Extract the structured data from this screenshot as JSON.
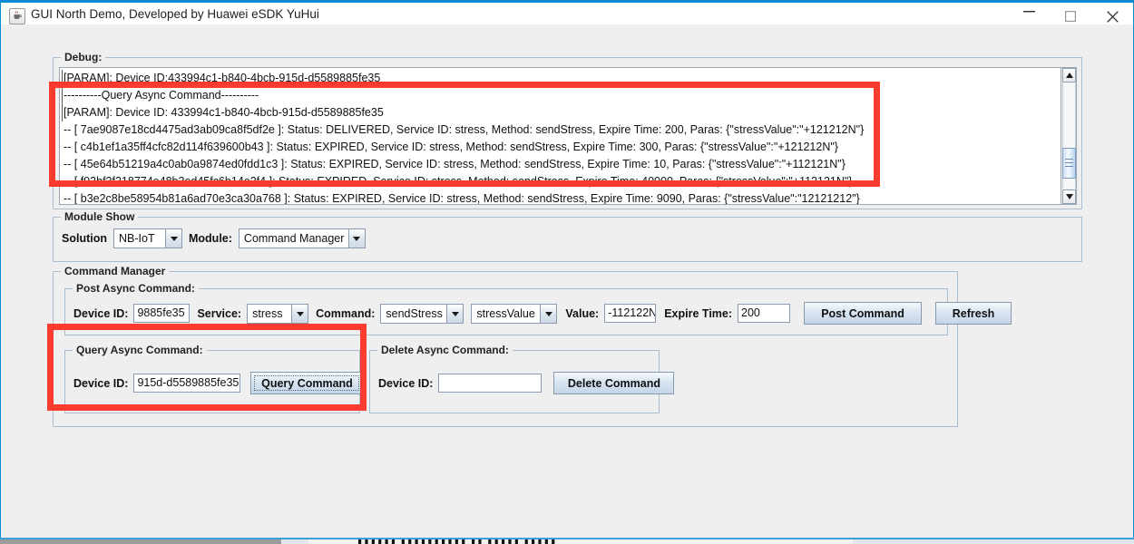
{
  "window": {
    "title": "GUI North Demo, Developed by Huawei eSDK YuHui",
    "app_icon": "java-coffee-cup-icon",
    "controls": {
      "minimize": "minimize-icon",
      "maximize": "maximize-icon",
      "close": "close-icon"
    },
    "accent_color": "#0a8bd8"
  },
  "debug": {
    "group_title": "Debug:",
    "lines": [
      "[PARAM]: Device ID:433994c1-b840-4bcb-915d-d5589885fe35",
      "----------Query Async Command----------",
      "[PARAM]: Device ID: 433994c1-b840-4bcb-915d-d5589885fe35",
      "-- [ 7ae9087e18cd4475ad3ab09ca8f5df2e ]: Status: DELIVERED, Service ID: stress, Method: sendStress, Expire Time: 200, Paras: {\"stressValue\":\"+121212N\"}",
      "-- [ c4b1ef1a35ff4cfc82d114f639600b43 ]: Status: EXPIRED, Service ID: stress, Method: sendStress, Expire Time: 300, Paras: {\"stressValue\":\"+121212N\"}",
      "-- [ 45e64b51219a4c0ab0a9874ed0fdd1c3 ]: Status: EXPIRED, Service ID: stress, Method: sendStress, Expire Time: 10, Paras: {\"stressValue\":\"+112121N\"}",
      "-- [ f93bf3f318774e48b3ed45fc6b14e2f4 ]: Status: EXPIRED, Service ID: stress, Method: sendStress, Expire Time: 40000, Paras: {\"stressValue\":\"+112121N\"}",
      "-- [ b3e2c8be58954b81a6ad70e3ca30a768 ]: Status: EXPIRED, Service ID: stress, Method: sendStress, Expire Time: 9090, Paras: {\"stressValue\":\"12121212\"}"
    ],
    "scrollbar": {
      "up_arrow": "caret-up-icon",
      "down_arrow": "caret-down-icon"
    }
  },
  "module_show": {
    "group_title": "Module Show",
    "solution_label": "Solution",
    "solution_value": "NB-IoT",
    "module_label": "Module:",
    "module_value": "Command Manager"
  },
  "command_manager": {
    "group_title": "Command Manager",
    "post": {
      "group_title": "Post Async Command:",
      "device_id_label": "Device ID:",
      "device_id_value": "9885fe35",
      "service_label": "Service:",
      "service_value": "stress",
      "command_label": "Command:",
      "command_value": "sendStress",
      "param_value": "stressValue",
      "value_label": "Value:",
      "value_value": "-112122N",
      "expire_label": "Expire Time:",
      "expire_value": "200",
      "post_button": "Post Command",
      "refresh_button": "Refresh"
    },
    "query": {
      "group_title": "Query Async Command:",
      "device_id_label": "Device ID:",
      "device_id_value": "915d-d5589885fe35",
      "query_button": "Query Command"
    },
    "delete": {
      "group_title": "Delete Async Command:",
      "device_id_label": "Device ID:",
      "device_id_value": "",
      "device_id_placeholder": "",
      "delete_button": "Delete Command"
    }
  },
  "annotations": {
    "color": "#fb3b30",
    "boxes": [
      {
        "name": "debug-output-highlight"
      },
      {
        "name": "query-async-command-highlight"
      }
    ]
  }
}
